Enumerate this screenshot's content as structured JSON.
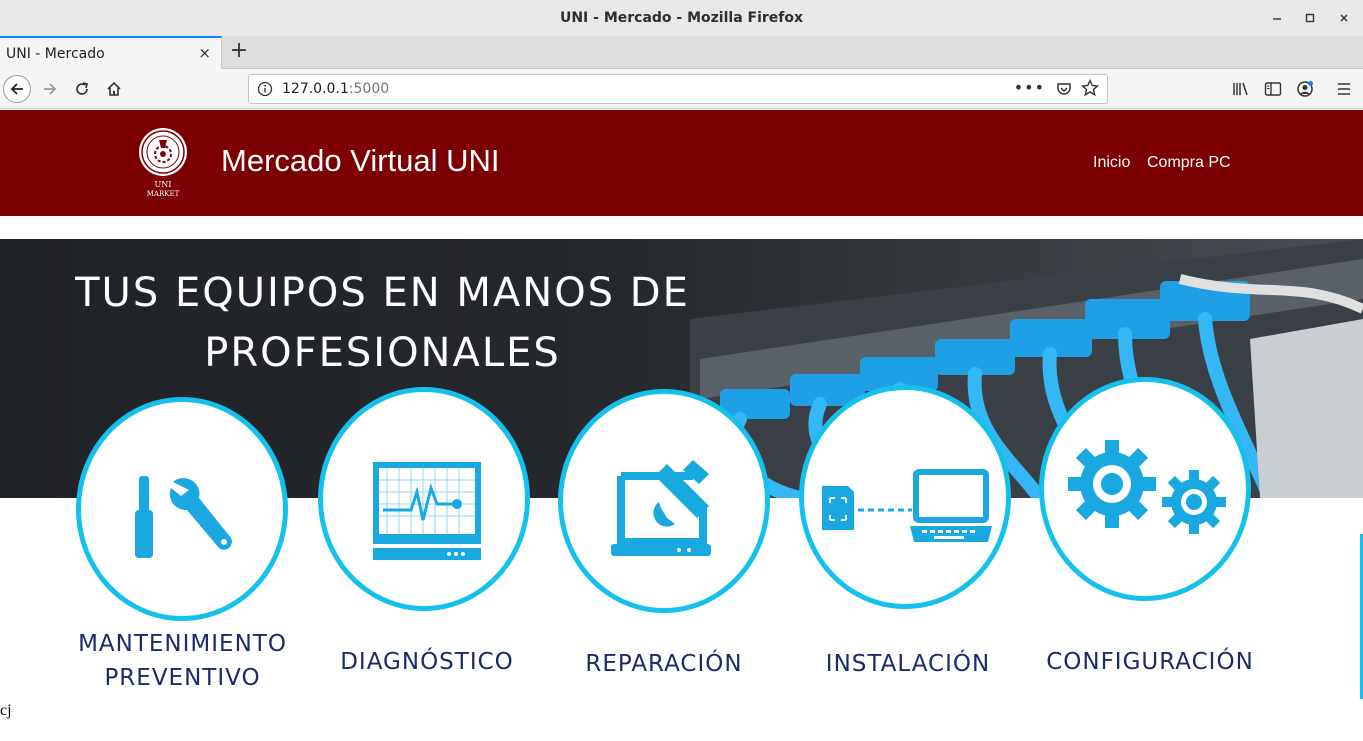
{
  "window": {
    "title": "UNI - Mercado - Mozilla Firefox"
  },
  "tab": {
    "label": "UNI - Mercado",
    "close": "×",
    "new_tab": "+"
  },
  "urlbar": {
    "host": "127.0.0.1",
    "port": ":5000",
    "more": "•••"
  },
  "header": {
    "logo_text": [
      "UNI",
      "MARKET"
    ],
    "title": "Mercado Virtual UNI",
    "nav": [
      "Inicio",
      "Compra PC"
    ]
  },
  "banner": {
    "headline_line1": "TUS EQUIPOS EN MANOS DE",
    "headline_line2": "PROFESIONALES",
    "services": [
      {
        "label_line1": "MANTENIMIENTO",
        "label_line2": "PREVENTIVO",
        "icon": "tools-icon"
      },
      {
        "label_line1": "DIAGNÓSTICO",
        "label_line2": "",
        "icon": "diagnostic-monitor-icon"
      },
      {
        "label_line1": "REPARACIÓN",
        "label_line2": "",
        "icon": "laptop-repair-icon"
      },
      {
        "label_line1": "INSTALACIÓN",
        "label_line2": "",
        "icon": "sim-to-laptop-icon"
      },
      {
        "label_line1": "CONFIGURACIÓN",
        "label_line2": "",
        "icon": "gears-icon"
      }
    ],
    "accent_color": "#14c1ec",
    "label_color": "#1b2a6b"
  },
  "colors": {
    "header_bg": "#7c0001",
    "tab_accent": "#0a84ff"
  },
  "stray_text": "cj"
}
